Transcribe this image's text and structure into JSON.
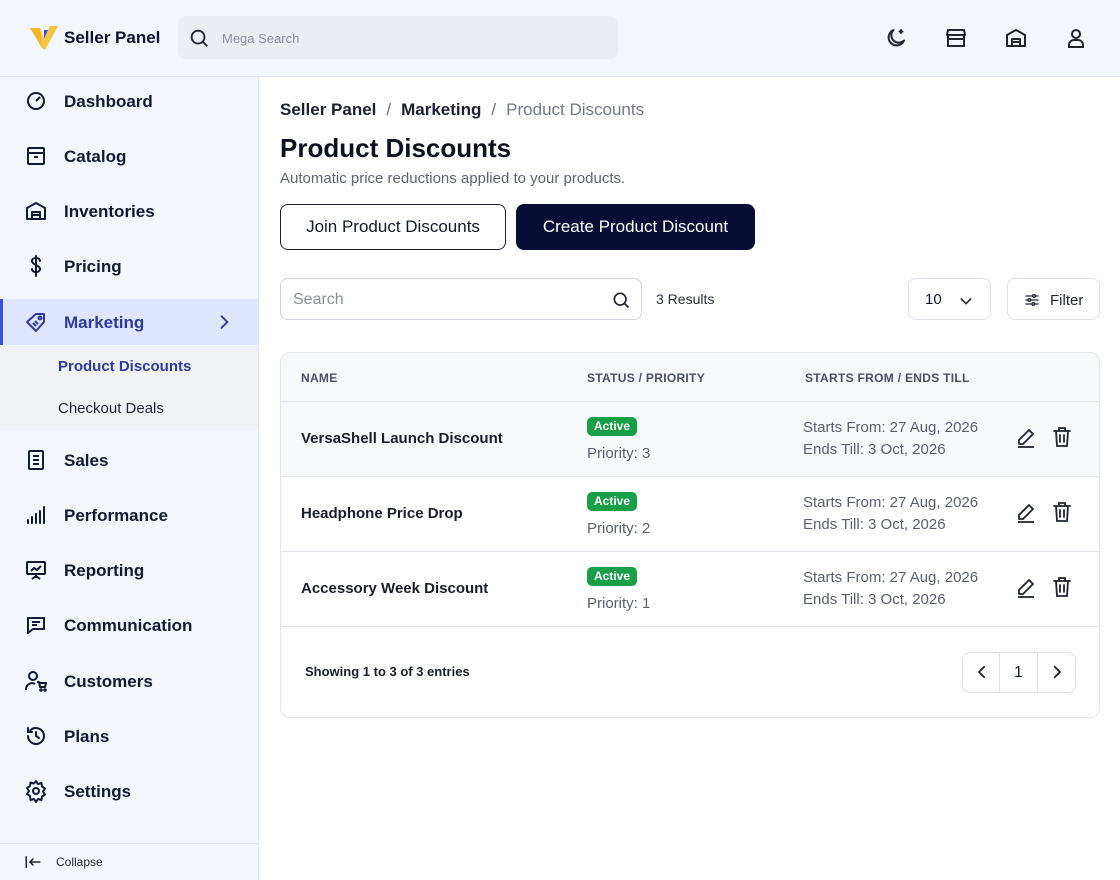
{
  "header": {
    "brand": "Seller Panel",
    "search_placeholder": "Mega Search",
    "icons": [
      "moon-icon",
      "store-icon",
      "warehouse-icon",
      "user-icon"
    ]
  },
  "sidebar": {
    "items": [
      {
        "label": "Dashboard",
        "icon": "gauge-icon"
      },
      {
        "label": "Catalog",
        "icon": "box-icon"
      },
      {
        "label": "Inventories",
        "icon": "warehouse-icon"
      },
      {
        "label": "Pricing",
        "icon": "dollar-icon"
      },
      {
        "label": "Marketing",
        "icon": "ticket-icon",
        "active": true
      },
      {
        "label": "Sales",
        "icon": "document-icon"
      },
      {
        "label": "Performance",
        "icon": "bar-chart-icon"
      },
      {
        "label": "Reporting",
        "icon": "presentation-icon"
      },
      {
        "label": "Communication",
        "icon": "message-icon"
      },
      {
        "label": "Customers",
        "icon": "customer-cart-icon"
      },
      {
        "label": "Plans",
        "icon": "history-icon"
      },
      {
        "label": "Settings",
        "icon": "gear-icon"
      }
    ],
    "submenu": [
      {
        "label": "Product Discounts",
        "active": true
      },
      {
        "label": "Checkout Deals"
      }
    ],
    "collapse_label": "Collapse"
  },
  "breadcrumb": {
    "items": [
      "Seller Panel",
      "Marketing"
    ],
    "current": "Product Discounts",
    "separator": "/"
  },
  "page": {
    "title": "Product Discounts",
    "subtitle": "Automatic price reductions applied to your products.",
    "join_button": "Join Product Discounts",
    "create_button": "Create Product Discount"
  },
  "toolbar": {
    "search_placeholder": "Search",
    "results": "3 Results",
    "per_page": "10",
    "filter_label": "Filter"
  },
  "table": {
    "columns": [
      "NAME",
      "STATUS / PRIORITY",
      "STARTS FROM / ENDS TILL"
    ],
    "rows": [
      {
        "name": "VersaShell Launch Discount",
        "status": "Active",
        "priority": "Priority: 3",
        "starts": "Starts From: 27 Aug, 2026",
        "ends": "Ends Till: 3 Oct, 2026"
      },
      {
        "name": "Headphone Price Drop",
        "status": "Active",
        "priority": "Priority: 2",
        "starts": "Starts From: 27 Aug, 2026",
        "ends": "Ends Till: 3 Oct, 2026"
      },
      {
        "name": "Accessory Week Discount",
        "status": "Active",
        "priority": "Priority: 1",
        "starts": "Starts From: 27 Aug, 2026",
        "ends": "Ends Till: 3 Oct, 2026"
      }
    ],
    "showing": "Showing 1 to 3 of 3 entries",
    "current_page": "1"
  },
  "colors": {
    "accent": "#2e3a9e",
    "primary_button": "#0a0e37",
    "active_badge": "#17a047",
    "sidebar_bg": "#f4f6fd"
  }
}
